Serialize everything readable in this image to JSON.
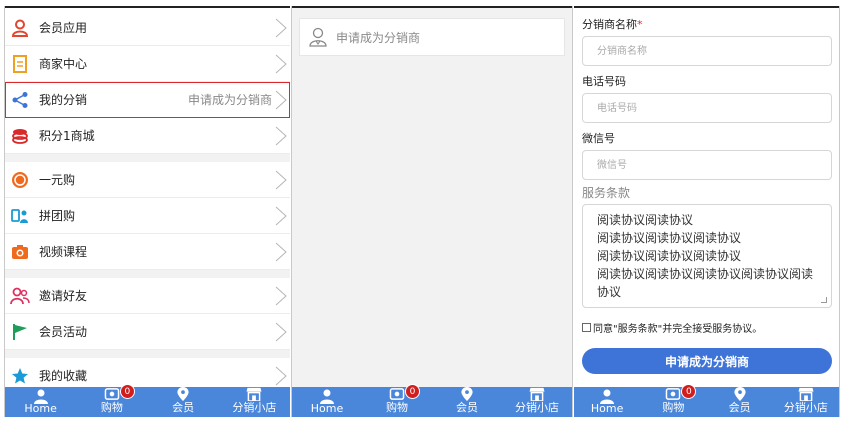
{
  "menu": {
    "items": [
      {
        "label": "会员应用",
        "sub": ""
      },
      {
        "label": "商家中心",
        "sub": ""
      },
      {
        "label": "我的分销",
        "sub": "申请成为分销商"
      },
      {
        "label": "积分1商城",
        "sub": ""
      },
      {
        "label": "一元购",
        "sub": ""
      },
      {
        "label": "拼团购",
        "sub": ""
      },
      {
        "label": "视频课程",
        "sub": ""
      },
      {
        "label": "邀请好友",
        "sub": ""
      },
      {
        "label": "会员活动",
        "sub": ""
      },
      {
        "label": "我的收藏",
        "sub": ""
      }
    ]
  },
  "nav": {
    "home": "Home",
    "cart": "购物",
    "cart_badge": "0",
    "member": "会员",
    "shop": "分销小店"
  },
  "apply": {
    "label": "申请成为分销商"
  },
  "form": {
    "name_label": "分销商名称",
    "name_required": "*",
    "name_placeholder": "分销商名称",
    "phone_label": "电话号码",
    "phone_placeholder": "电话号码",
    "wechat_label": "微信号",
    "wechat_placeholder": "微信号",
    "terms_label": "服务条款",
    "terms_lines": [
      "阅读协议阅读协议",
      "阅读协议阅读协议阅读协议",
      "阅读协议阅读协议阅读协议",
      "阅读协议阅读协议阅读协议阅读协议阅读",
      "协议"
    ],
    "agree_text": "同意\"服务条款\"并完全接受服务协议。",
    "submit_label": "申请成为分销商"
  },
  "colors": {
    "nav_bg": "#4a86d9",
    "button_bg": "#3e74d8",
    "badge_bg": "#d01e1e",
    "selected_outline": "#d9292b"
  }
}
